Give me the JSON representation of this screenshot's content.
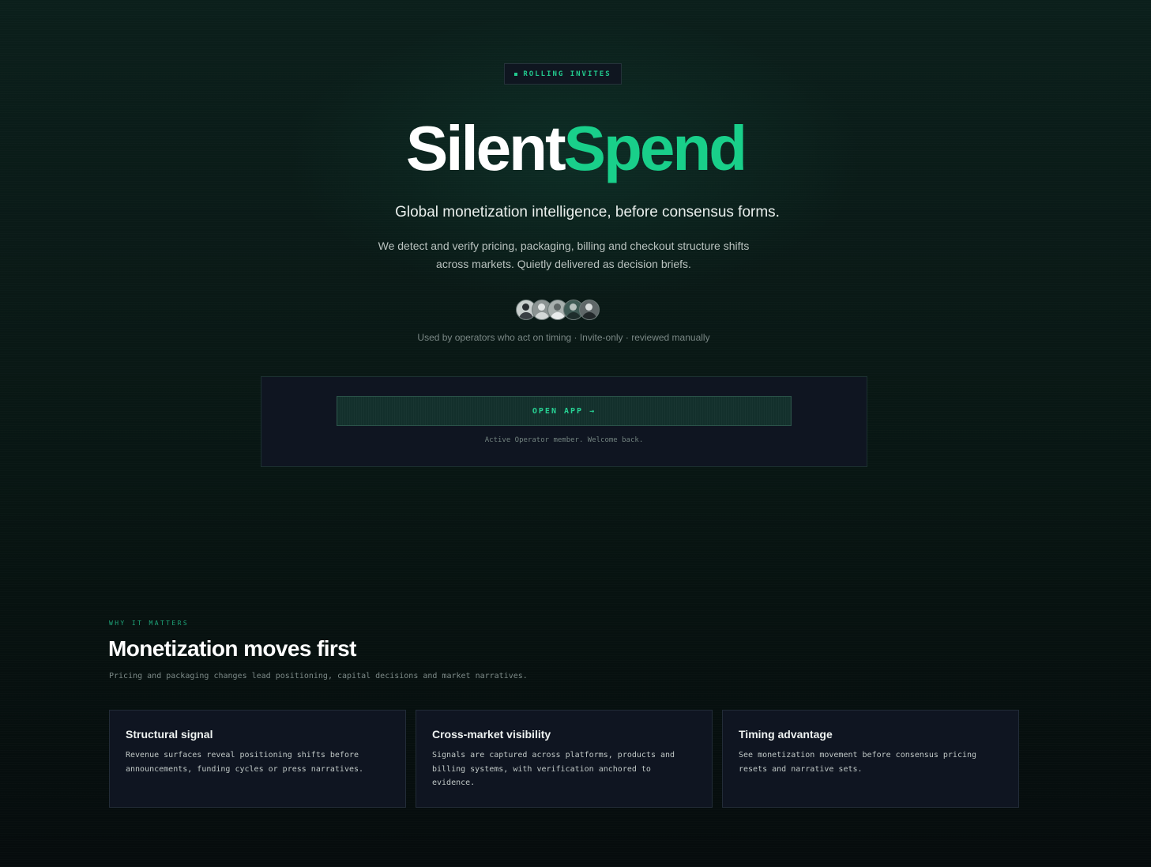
{
  "badge": {
    "label": "ROLLING INVITES"
  },
  "hero": {
    "brand_white": "Silent",
    "brand_green": "Spend",
    "tagline": "Global monetization intelligence, before consensus forms.",
    "description_line1": "We detect and verify pricing, packaging, billing and checkout structure shifts",
    "description_line2": "across markets. Quietly delivered as decision briefs.",
    "social_proof": "Used by operators who act on timing · Invite-only · reviewed manually"
  },
  "avatars": [
    {
      "name": "operator-1"
    },
    {
      "name": "operator-2"
    },
    {
      "name": "operator-3"
    },
    {
      "name": "operator-4"
    },
    {
      "name": "operator-5"
    }
  ],
  "cta": {
    "open_app_label": "OPEN APP",
    "arrow": "→",
    "member_note": "Active Operator member. Welcome back."
  },
  "section": {
    "eyebrow": "WHY IT MATTERS",
    "title": "Monetization moves first",
    "subtitle": "Pricing and packaging changes lead positioning, capital decisions and market narratives."
  },
  "cards": [
    {
      "title": "Structural signal",
      "body_lines": [
        "Revenue surfaces reveal positioning shifts before",
        "announcements, funding cycles or press narratives."
      ]
    },
    {
      "title": "Cross-market visibility",
      "body_lines": [
        "Signals are captured across platforms, products and",
        "billing systems, with verification anchored to",
        "evidence."
      ]
    },
    {
      "title": "Timing advantage",
      "body_lines": [
        "See monetization movement before consensus pricing",
        "resets and narrative sets."
      ]
    }
  ],
  "colors": {
    "accent": "#19cf8a",
    "background": "#0a1a17",
    "card": "#0f1521"
  }
}
